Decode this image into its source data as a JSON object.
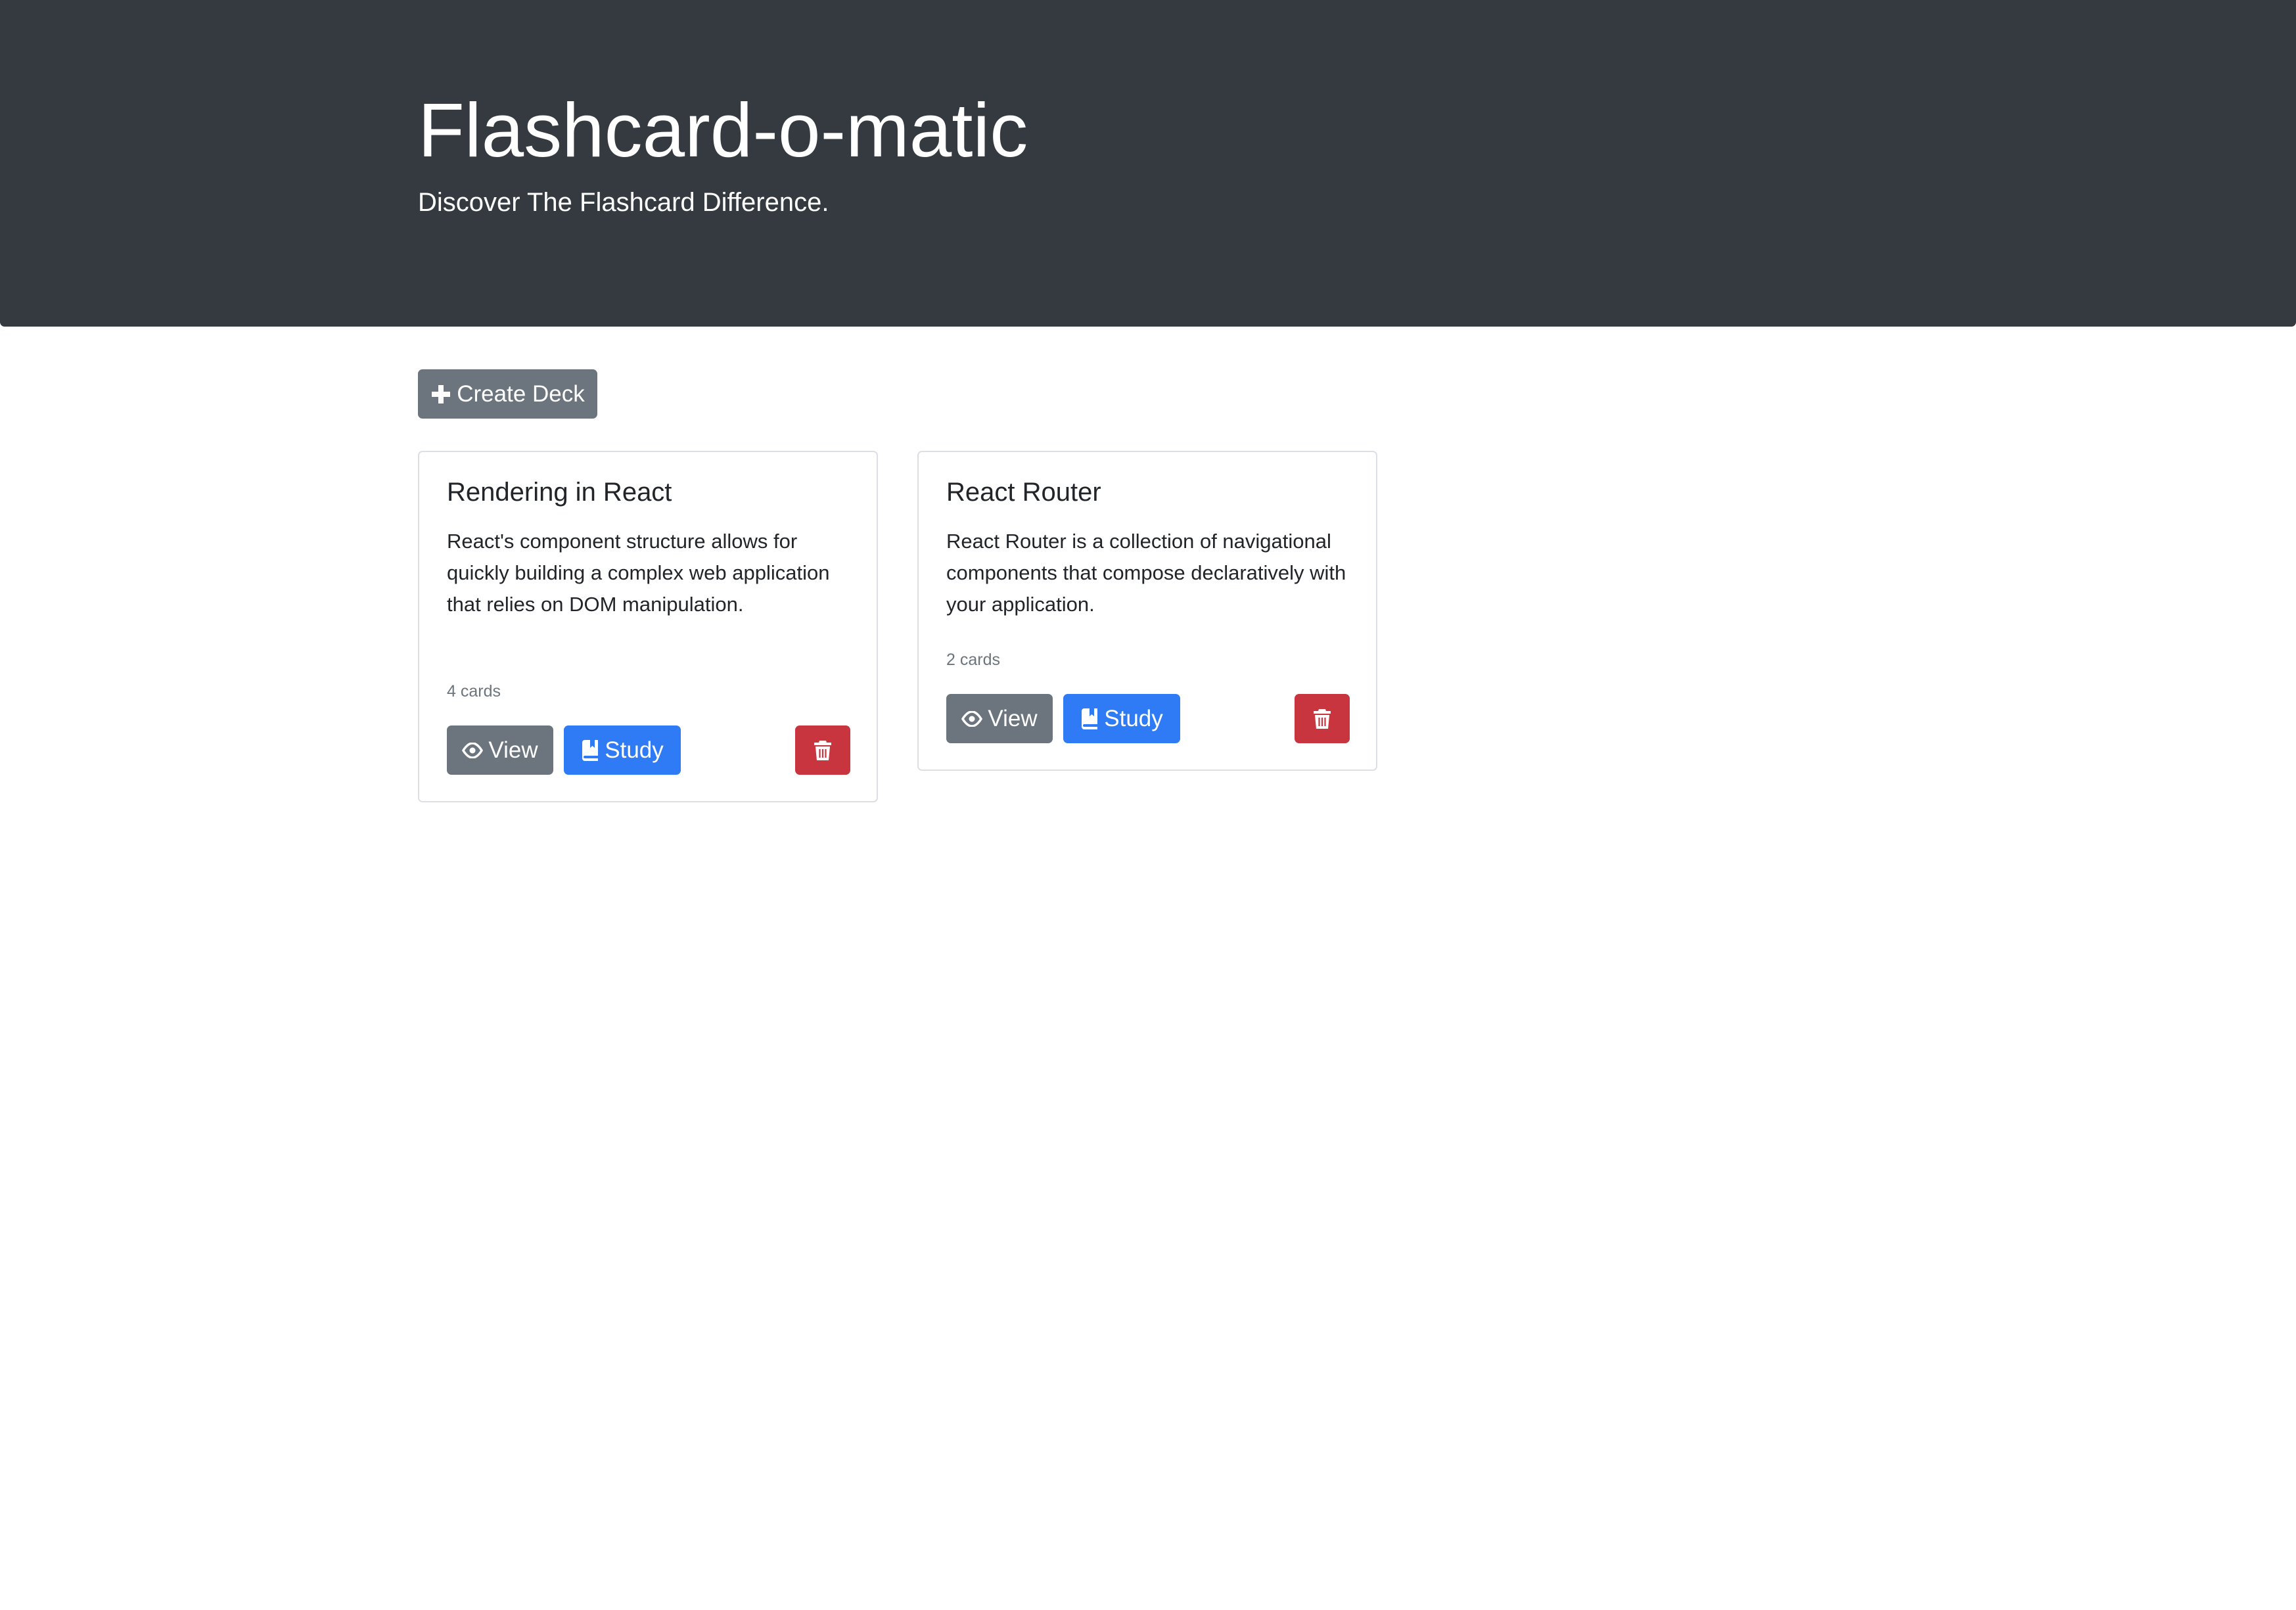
{
  "header": {
    "title": "Flashcard-o-matic",
    "tagline": "Discover The Flashcard Difference."
  },
  "toolbar": {
    "create_label": "Create Deck",
    "create_icon": "plus-icon"
  },
  "decks": [
    {
      "name": "Rendering in React",
      "description": "React's component structure allows for quickly building a complex web application that relies on DOM manipulation.",
      "count": "4 cards",
      "view_label": "View",
      "study_label": "Study"
    },
    {
      "name": "React Router",
      "description": "React Router is a collection of navigational components that compose declaratively with your application.",
      "count": "2 cards",
      "view_label": "View",
      "study_label": "Study"
    }
  ],
  "icons": {
    "view": "eye-icon",
    "study": "book-icon",
    "delete": "trash-icon"
  },
  "colors": {
    "header_bg": "#343a40",
    "secondary": "#6c757d",
    "primary": "#2f7bf5",
    "danger": "#c9353f"
  }
}
